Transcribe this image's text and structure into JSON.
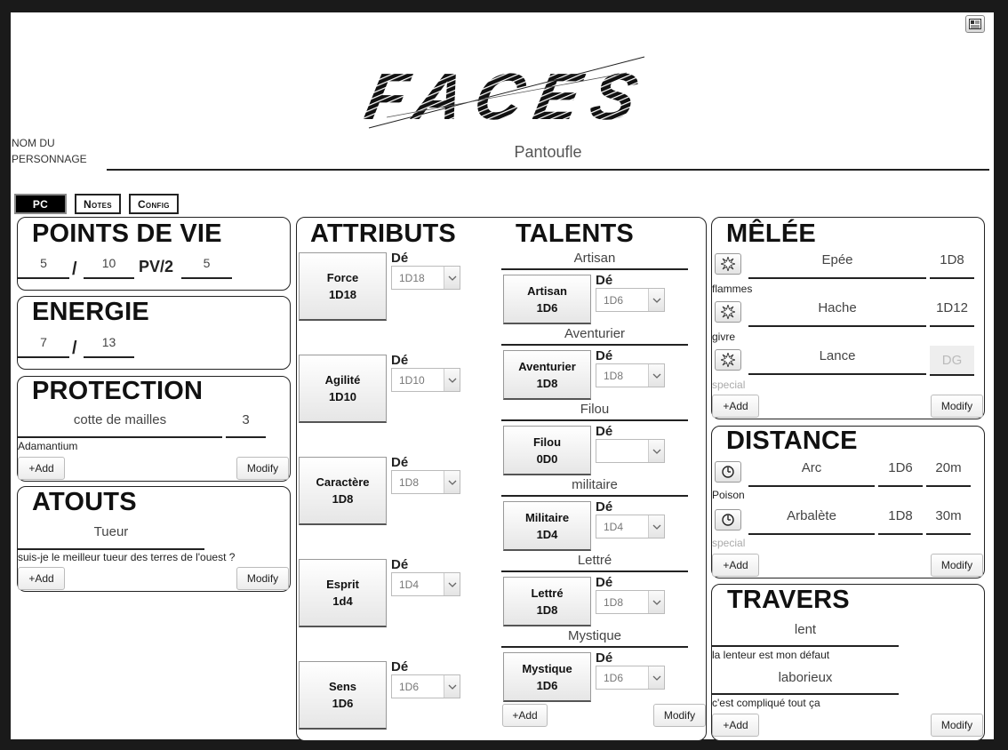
{
  "app": {
    "logo_text": "FACES"
  },
  "character": {
    "name_label_1": "NOM DU",
    "name_label_2": "PERSONNAGE",
    "name": "Pantoufle"
  },
  "tabs": [
    "PC",
    "Notes",
    "Config"
  ],
  "points_de_vie": {
    "title": "POINTS DE VIE",
    "current": "5",
    "separator": "/",
    "max": "10",
    "half_label": "PV/2",
    "half": "5"
  },
  "energie": {
    "title": "ENERGIE",
    "current": "7",
    "separator": "/",
    "max": "13"
  },
  "protection": {
    "title": "PROTECTION",
    "armor": "cotte de mailles",
    "value": "3",
    "note": "Adamantium",
    "add_label": "+Add",
    "modify_label": "Modify"
  },
  "atouts": {
    "title": "ATOUTS",
    "name": "Tueur",
    "note": "suis-je le meilleur tueur des terres de l'ouest ?",
    "add_label": "+Add",
    "modify_label": "Modify"
  },
  "attributs": {
    "title": "ATTRIBUTS",
    "de_label": "Dé",
    "items": [
      {
        "name": "Force",
        "dice": "1D18",
        "select": "1D18"
      },
      {
        "name": "Agilité",
        "dice": "1D10",
        "select": "1D10"
      },
      {
        "name": "Caractère",
        "dice": "1D8",
        "select": "1D8"
      },
      {
        "name": "Esprit",
        "dice": "1d4",
        "select": "1D4"
      },
      {
        "name": "Sens",
        "dice": "1D6",
        "select": "1D6"
      }
    ]
  },
  "talents": {
    "title": "TALENTS",
    "de_label": "Dé",
    "add_label": "+Add",
    "modify_label": "Modify",
    "items": [
      {
        "category": "Artisan",
        "name": "Artisan",
        "dice": "1D6",
        "select": "1D6"
      },
      {
        "category": "Aventurier",
        "name": "Aventurier",
        "dice": "1D8",
        "select": "1D8"
      },
      {
        "category": "Filou",
        "name": "Filou",
        "dice": "0D0",
        "select": ""
      },
      {
        "category": "militaire",
        "name": "Militaire",
        "dice": "1D4",
        "select": "1D4"
      },
      {
        "category": "Lettré",
        "name": "Lettré",
        "dice": "1D8",
        "select": "1D8"
      },
      {
        "category": "Mystique",
        "name": "Mystique",
        "dice": "1D6",
        "select": "1D6"
      }
    ]
  },
  "melee": {
    "title": "MÊLÉE",
    "add_label": "+Add",
    "modify_label": "Modify",
    "items": [
      {
        "name": "Epée",
        "damage": "1D8",
        "note": "flammes"
      },
      {
        "name": "Hache",
        "damage": "1D12",
        "note": "givre"
      },
      {
        "name": "Lance",
        "damage": "DG",
        "note": "special"
      }
    ]
  },
  "distance": {
    "title": "DISTANCE",
    "add_label": "+Add",
    "modify_label": "Modify",
    "items": [
      {
        "name": "Arc",
        "damage": "1D6",
        "range": "20m",
        "note": "Poison"
      },
      {
        "name": "Arbalète",
        "damage": "1D8",
        "range": "30m",
        "note": "special"
      }
    ]
  },
  "travers": {
    "title": "TRAVERS",
    "add_label": "+Add",
    "modify_label": "Modify",
    "items": [
      {
        "name": "lent",
        "note": "la lenteur est mon défaut"
      },
      {
        "name": "laborieux",
        "note": "c'est compliqué tout ça"
      }
    ]
  }
}
